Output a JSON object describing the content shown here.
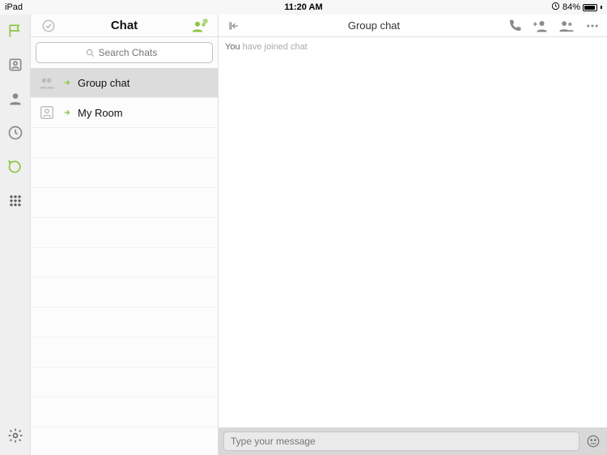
{
  "status": {
    "device": "iPad",
    "time": "11:20 AM",
    "battery_pct": "84%"
  },
  "list": {
    "title": "Chat",
    "search_placeholder": "Search Chats",
    "items": [
      {
        "label": "Group chat"
      },
      {
        "label": "My Room"
      }
    ]
  },
  "chat": {
    "title": "Group chat",
    "system_msg_you": "You",
    "system_msg_rest": "have joined chat",
    "composer_placeholder": "Type your message"
  },
  "colors": {
    "accent": "#8bc53f",
    "grey": "#8a8a8a"
  }
}
